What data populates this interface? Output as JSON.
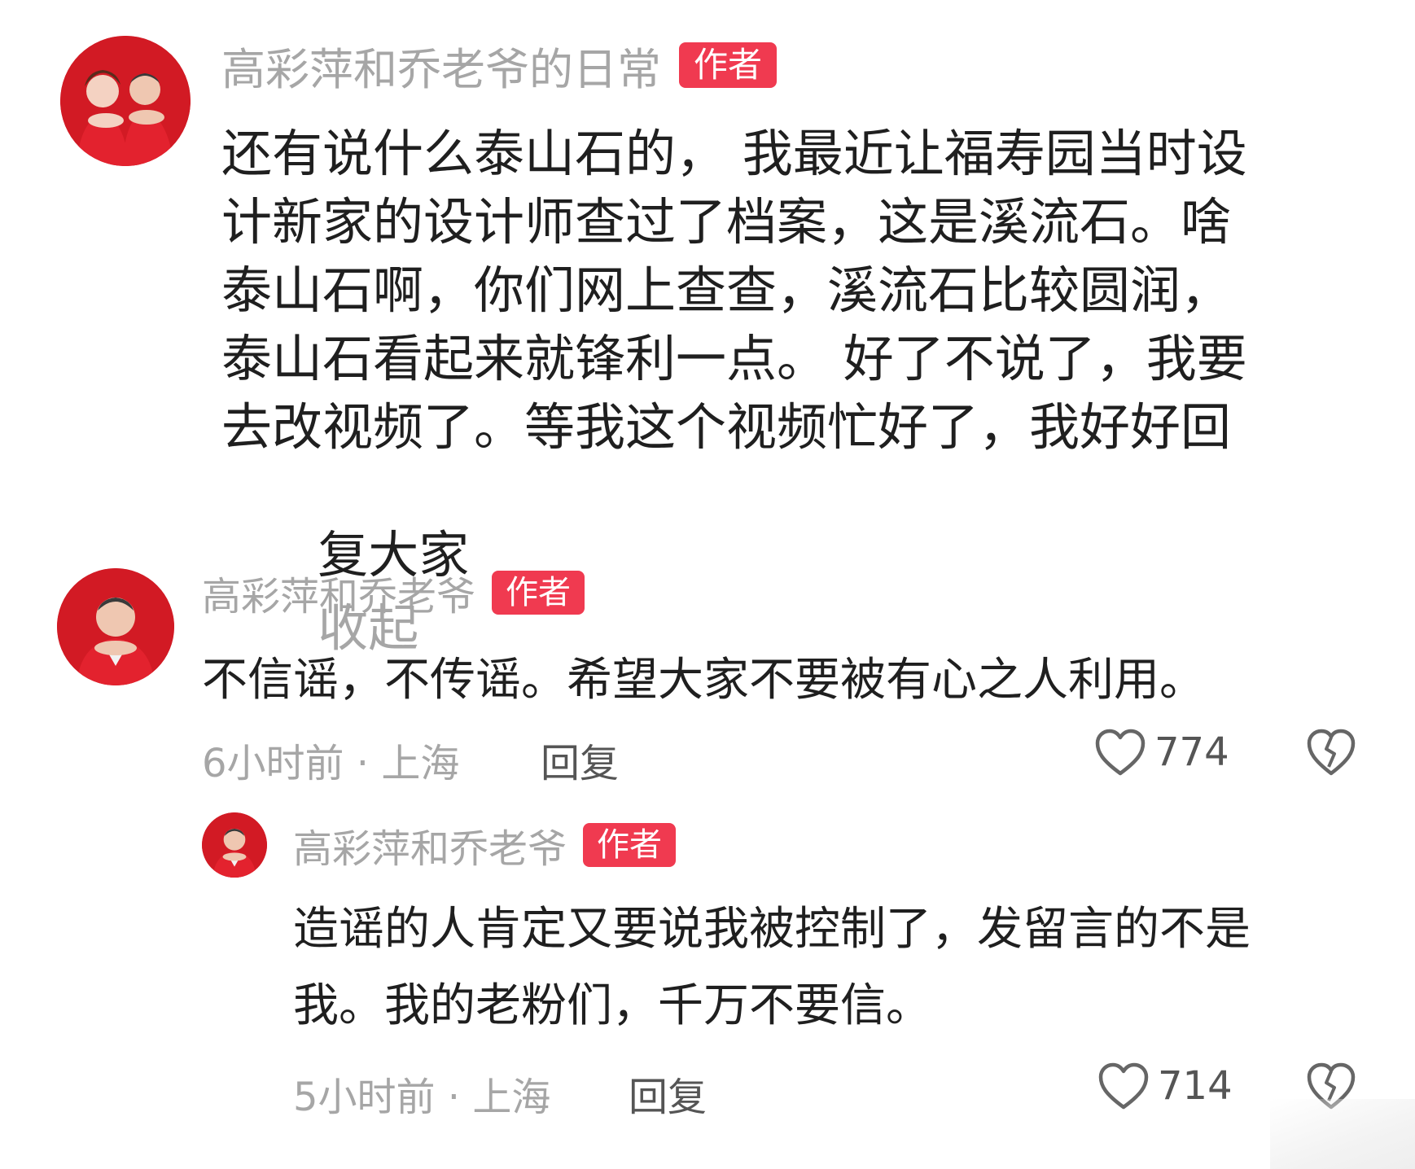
{
  "comments": [
    {
      "author": "高彩萍和乔老爷的日常",
      "badge": "作者",
      "lines": [
        "还有说什么泰山石的， 我最近让福寿园当时设",
        "计新家的设计师查过了档案，这是溪流石。啥",
        "泰山石啊，你们网上查查，溪流石比较圆润，",
        "泰山石看起来就锋利一点。 好了不说了，我要",
        "去改视频了。等我这个视频忙好了，我好好回",
        "复大家"
      ],
      "collapse_label": "收起",
      "avatar_icon": "couple-avatar"
    },
    {
      "author": "高彩萍和乔老爷",
      "badge": "作者",
      "text": "不信谣，不传谣。希望大家不要被有心之人利用。",
      "meta": "6小时前 · 上海",
      "reply_label": "回复",
      "likes": "774",
      "avatar_icon": "man-avatar"
    },
    {
      "author": "高彩萍和乔老爷",
      "badge": "作者",
      "lines": [
        "造谣的人肯定又要说我被控制了，发留言的不是",
        "我。我的老粉们，千万不要信。"
      ],
      "meta": "5小时前 · 上海",
      "reply_label": "回复",
      "likes": "714",
      "avatar_icon": "man-avatar"
    }
  ],
  "icons": {
    "like": "heart-outline-icon",
    "dislike": "broken-heart-icon"
  },
  "colors": {
    "badge": "#f03a50",
    "muted_text": "#a6a6a6",
    "body_text": "#1f1f1f",
    "avatar_red": "#c8101c"
  }
}
